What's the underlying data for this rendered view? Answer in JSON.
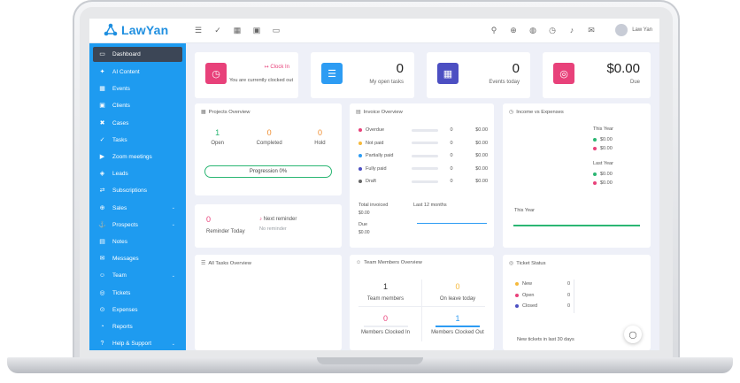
{
  "app": {
    "name": "LawYan",
    "user_name": "Law Yan"
  },
  "colors": {
    "sidebar": "#1e9bf0",
    "active": "#3c4656",
    "pink": "#e8417a",
    "blue": "#2d9cf3",
    "indigo": "#4c4fc2",
    "green": "#2bb673"
  },
  "sidebar": {
    "items": [
      {
        "label": "Dashboard",
        "icon": "monitor-icon",
        "glyph": "▭",
        "chevron": false
      },
      {
        "label": "AI Content",
        "icon": "ai-icon",
        "glyph": "✦",
        "chevron": false
      },
      {
        "label": "Events",
        "icon": "calendar-icon",
        "glyph": "▦",
        "chevron": false
      },
      {
        "label": "Clients",
        "icon": "briefcase-icon",
        "glyph": "▣",
        "chevron": false
      },
      {
        "label": "Cases",
        "icon": "cases-icon",
        "glyph": "✖",
        "chevron": false
      },
      {
        "label": "Tasks",
        "icon": "check-icon",
        "glyph": "✓",
        "chevron": false
      },
      {
        "label": "Zoom meetings",
        "icon": "video-icon",
        "glyph": "▶",
        "chevron": false
      },
      {
        "label": "Leads",
        "icon": "layers-icon",
        "glyph": "◈",
        "chevron": false
      },
      {
        "label": "Subscriptions",
        "icon": "repeat-icon",
        "glyph": "⇄",
        "chevron": false
      },
      {
        "label": "Sales",
        "icon": "cart-icon",
        "glyph": "⊕",
        "chevron": true
      },
      {
        "label": "Prospects",
        "icon": "anchor-icon",
        "glyph": "⚓",
        "chevron": true
      },
      {
        "label": "Notes",
        "icon": "note-icon",
        "glyph": "▤",
        "chevron": false
      },
      {
        "label": "Messages",
        "icon": "message-icon",
        "glyph": "✉",
        "chevron": false
      },
      {
        "label": "Team",
        "icon": "users-icon",
        "glyph": "☺",
        "chevron": true
      },
      {
        "label": "Tickets",
        "icon": "ticket-icon",
        "glyph": "◎",
        "chevron": false
      },
      {
        "label": "Expenses",
        "icon": "expense-icon",
        "glyph": "⊙",
        "chevron": false
      },
      {
        "label": "Reports",
        "icon": "chart-icon",
        "glyph": "◔",
        "chevron": false
      },
      {
        "label": "Help & Support",
        "icon": "help-icon",
        "glyph": "?",
        "chevron": true
      }
    ]
  },
  "stats": {
    "clock": {
      "button": "Clock In",
      "text": "You are currently clocked out"
    },
    "open_tasks": {
      "value": "0",
      "label": "My open tasks"
    },
    "events_today": {
      "value": "0",
      "label": "Events today"
    },
    "due": {
      "value": "$0.00",
      "label": "Due"
    }
  },
  "projects": {
    "title": "Projects Overview",
    "open": {
      "value": "1",
      "label": "Open"
    },
    "completed": {
      "value": "0",
      "label": "Completed"
    },
    "hold": {
      "value": "0",
      "label": "Hold"
    },
    "progress_label": "Progression 0%"
  },
  "invoice": {
    "title": "Invoice Overview",
    "rows": [
      {
        "label": "Overdue",
        "count": "0",
        "amount": "$0.00",
        "color": "#e8417a"
      },
      {
        "label": "Not paid",
        "count": "0",
        "amount": "$0.00",
        "color": "#f6b93b"
      },
      {
        "label": "Partially paid",
        "count": "0",
        "amount": "$0.00",
        "color": "#2d9cf3"
      },
      {
        "label": "Fully paid",
        "count": "0",
        "amount": "$0.00",
        "color": "#4c4fc2"
      },
      {
        "label": "Draft",
        "count": "0",
        "amount": "$0.00",
        "color": "#666666"
      }
    ],
    "total_invoiced_label": "Total invoiced",
    "total_invoiced_value": "$0.00",
    "due_label": "Due",
    "due_value": "$0.00",
    "period": "Last 12 months"
  },
  "income": {
    "title": "Income vs Expenses",
    "this_year_label": "This Year",
    "this_year": [
      "$0.00",
      "$0.00"
    ],
    "last_year_label": "Last Year",
    "last_year": [
      "$0.00",
      "$0.00"
    ],
    "chart_label": "This Year"
  },
  "reminder": {
    "count": "0",
    "count_label": "Reminder Today",
    "next_label": "Next reminder",
    "next_value": "No reminder"
  },
  "all_tasks": {
    "title": "All Tasks Overview"
  },
  "team": {
    "title": "Team Members Overview",
    "members": {
      "value": "1",
      "label": "Team members"
    },
    "leave": {
      "value": "0",
      "label": "On leave today"
    },
    "clocked_in": {
      "value": "0",
      "label": "Members Clocked In"
    },
    "clocked_out": {
      "value": "1",
      "label": "Members Clocked Out"
    }
  },
  "tickets": {
    "title": "Ticket Status",
    "rows": [
      {
        "label": "New",
        "count": "0",
        "color": "#f6b93b"
      },
      {
        "label": "Open",
        "count": "0",
        "color": "#e8417a"
      },
      {
        "label": "Closed",
        "count": "0",
        "color": "#4c4fc2"
      }
    ],
    "footer": "New tickets in last 30 days"
  }
}
